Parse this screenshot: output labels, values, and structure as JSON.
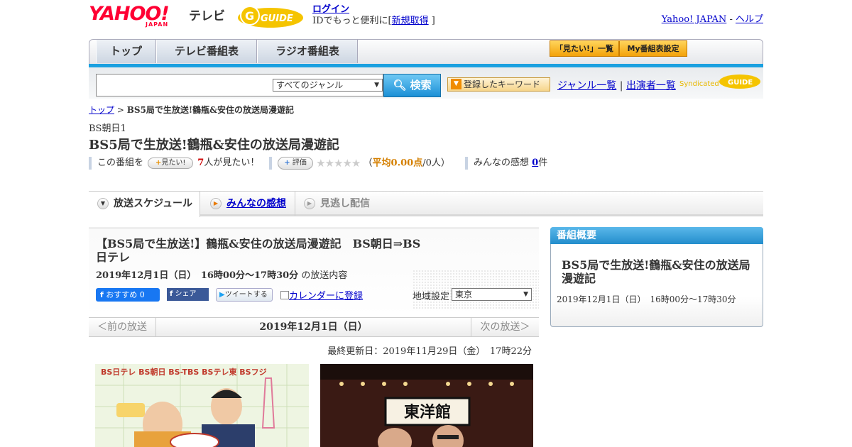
{
  "header": {
    "logo_yahoo": "YAHOO!",
    "logo_japan": "JAPAN",
    "logo_tv": "テレビ",
    "gguide_logo": "G-GUIDE",
    "login_label": "ログイン",
    "login_prompt": "IDでもっと便利に[",
    "signup_label": "新規取得",
    "login_prompt_end": "]",
    "yahoo_japan_link": "Yahoo! JAPAN",
    "separator": " - ",
    "help_link": "ヘルプ"
  },
  "nav": {
    "tabs": [
      {
        "label": "トップ"
      },
      {
        "label": "テレビ番組表"
      },
      {
        "label": "ラジオ番組表"
      }
    ],
    "mitai_list": "「見たい!」一覧",
    "my_schedule": "My番組表設定"
  },
  "search": {
    "genre_selected": "すべてのジャンル",
    "search_button": "検索",
    "keyword_button": "登録したキーワード",
    "genre_list_link": "ジャンル一覧",
    "divider": "|",
    "performer_list_link": "出演者一覧",
    "syndicated": "Syndicated"
  },
  "breadcrumb": {
    "top": "トップ",
    "sep": ">",
    "current": "BS5局で生放送!鶴瓶&安住の放送局漫遊記"
  },
  "program": {
    "channel": "BS朝日1",
    "title": "BS5局で生放送!鶴瓶&安住の放送局漫遊記",
    "this_program": "この番組を",
    "mitai_button": "見たい!",
    "mitai_count": "7",
    "mitai_suffix": "人が見たい！",
    "rating_button": "評価",
    "stars": "★★★★★",
    "avg_prefix": "（",
    "avg_value": "平均0.00点",
    "avg_suffix": "/0人）",
    "impressions_label": "みんなの感想",
    "impressions_count": "0",
    "impressions_suffix": "件"
  },
  "content_tabs": [
    {
      "label": "放送スケジュール",
      "icon": "triangle-down-icon"
    },
    {
      "label": "みんなの感想",
      "icon": "play-icon"
    },
    {
      "label": "見逃し配信",
      "icon": "play-icon"
    }
  ],
  "episode": {
    "title": "【BS5局で生放送!】鶴瓶&安住の放送局漫遊記　BS朝日⇒BS日テレ",
    "date_time": "2019年12月1日（日）　16時00分～17時30分",
    "date_suffix": "の放送内容",
    "fb_recommend": "おすすめ 0",
    "fb_share": "シェア",
    "tweet": "ツイートする",
    "calendar_link": "カレンダーに登録",
    "region_label": "地域設定",
    "region_value": "東京"
  },
  "pager": {
    "prev": "＜前の放送",
    "date": "2019年12月1日（日）",
    "next": "次の放送＞"
  },
  "updated": "最終更新日：2019年11月29日（金）　17時22分",
  "images": {
    "photo1_caption": "BS日テレ BS朝日 BS-TBS BSテレ東 BSフジ",
    "photo2_sign": "東洋館"
  },
  "sidebar": {
    "heading": "番組概要",
    "title": "BS5局で生放送!鶴瓶&安住の放送局漫遊記",
    "date_time": "2019年12月1日（日）　16時00分～17時30分"
  }
}
